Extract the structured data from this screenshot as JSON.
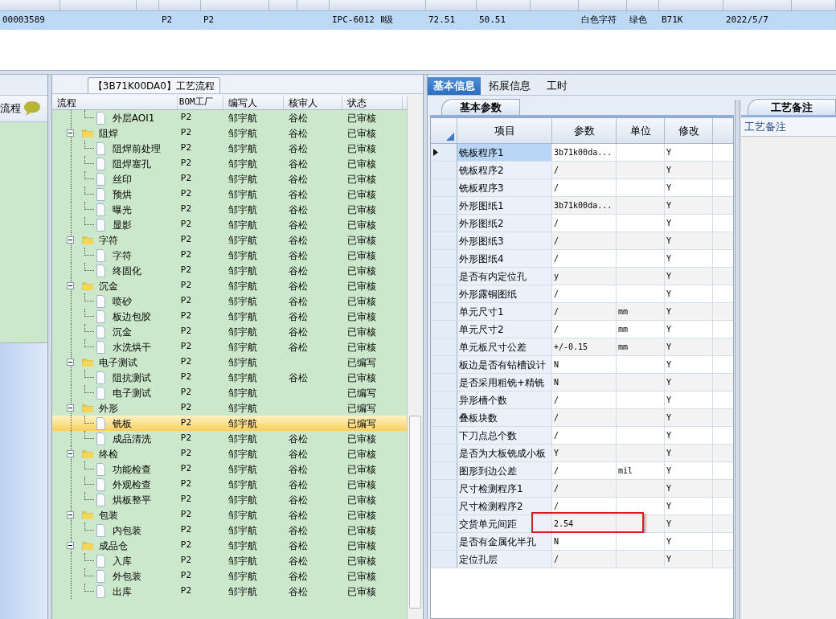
{
  "top_grid": {
    "row": {
      "selected": true,
      "cells": [
        "00003589",
        "",
        "",
        "P2",
        "P2",
        "",
        "",
        "IPC-6012 Ⅱ级",
        "72.51",
        "50.51",
        "",
        "白色字符",
        "绿色",
        "B71K",
        "2022/5/7",
        ""
      ]
    }
  },
  "left_panel": {
    "title": "流程"
  },
  "flow_panel": {
    "title": "【3B71K00DA0】工艺流程",
    "columns": [
      "流程",
      "BOM工厂",
      "编写人",
      "核审人",
      "状态"
    ],
    "nodes": [
      {
        "kind": "leaf",
        "label": "外层AOI1",
        "bom": "P2",
        "writer": "邹宇航",
        "reviewer": "谷松",
        "status": "已审核",
        "selected": false
      },
      {
        "kind": "group",
        "label": "阻焊",
        "expanded": true,
        "bom": "P2",
        "writer": "邹宇航",
        "reviewer": "谷松",
        "status": "已审核",
        "selected": false,
        "children": [
          {
            "kind": "leaf",
            "label": "阻焊前处理",
            "bom": "P2",
            "writer": "邹宇航",
            "reviewer": "谷松",
            "status": "已审核",
            "selected": false
          },
          {
            "kind": "leaf",
            "label": "阻焊塞孔",
            "bom": "P2",
            "writer": "邹宇航",
            "reviewer": "谷松",
            "status": "已审核",
            "selected": false
          },
          {
            "kind": "leaf",
            "label": "丝印",
            "bom": "P2",
            "writer": "邹宇航",
            "reviewer": "谷松",
            "status": "已审核",
            "selected": false
          },
          {
            "kind": "leaf",
            "label": "预烘",
            "bom": "P2",
            "writer": "邹宇航",
            "reviewer": "谷松",
            "status": "已审核",
            "selected": false
          },
          {
            "kind": "leaf",
            "label": "曝光",
            "bom": "P2",
            "writer": "邹宇航",
            "reviewer": "谷松",
            "status": "已审核",
            "selected": false
          },
          {
            "kind": "leaf",
            "label": "显影",
            "bom": "P2",
            "writer": "邹宇航",
            "reviewer": "谷松",
            "status": "已审核",
            "selected": false
          }
        ]
      },
      {
        "kind": "group",
        "label": "字符",
        "expanded": true,
        "bom": "P2",
        "writer": "邹宇航",
        "reviewer": "谷松",
        "status": "已审核",
        "selected": false,
        "children": [
          {
            "kind": "leaf",
            "label": "字符",
            "bom": "P2",
            "writer": "邹宇航",
            "reviewer": "谷松",
            "status": "已审核",
            "selected": false
          },
          {
            "kind": "leaf",
            "label": "终固化",
            "bom": "P2",
            "writer": "邹宇航",
            "reviewer": "谷松",
            "status": "已审核",
            "selected": false
          }
        ]
      },
      {
        "kind": "group",
        "label": "沉金",
        "expanded": true,
        "bom": "P2",
        "writer": "邹宇航",
        "reviewer": "谷松",
        "status": "已审核",
        "selected": false,
        "children": [
          {
            "kind": "leaf",
            "label": "喷砂",
            "bom": "P2",
            "writer": "邹宇航",
            "reviewer": "谷松",
            "status": "已审核",
            "selected": false
          },
          {
            "kind": "leaf",
            "label": "板边包胶",
            "bom": "P2",
            "writer": "邹宇航",
            "reviewer": "谷松",
            "status": "已审核",
            "selected": false
          },
          {
            "kind": "leaf",
            "label": "沉金",
            "bom": "P2",
            "writer": "邹宇航",
            "reviewer": "谷松",
            "status": "已审核",
            "selected": false
          },
          {
            "kind": "leaf",
            "label": "水洗烘干",
            "bom": "P2",
            "writer": "邹宇航",
            "reviewer": "谷松",
            "status": "已审核",
            "selected": false
          }
        ]
      },
      {
        "kind": "group",
        "label": "电子测试",
        "expanded": true,
        "bom": "P2",
        "writer": "邹宇航",
        "status": "已编写",
        "selected": false,
        "children": [
          {
            "kind": "leaf",
            "label": "阻抗测试",
            "bom": "P2",
            "writer": "邹宇航",
            "reviewer": "谷松",
            "status": "已审核",
            "selected": false
          },
          {
            "kind": "leaf",
            "label": "电子测试",
            "bom": "P2",
            "writer": "邹宇航",
            "status": "已编写",
            "selected": false
          }
        ]
      },
      {
        "kind": "group",
        "label": "外形",
        "expanded": true,
        "bom": "P2",
        "writer": "邹宇航",
        "status": "已编写",
        "selected": false,
        "children": [
          {
            "kind": "leaf",
            "label": "铣板",
            "bom": "P2",
            "writer": "邹宇航",
            "status": "已编写",
            "selected": true
          },
          {
            "kind": "leaf",
            "label": "成品清洗",
            "bom": "P2",
            "writer": "邹宇航",
            "reviewer": "谷松",
            "status": "已审核",
            "selected": false
          }
        ]
      },
      {
        "kind": "group",
        "label": "终检",
        "expanded": true,
        "bom": "P2",
        "writer": "邹宇航",
        "reviewer": "谷松",
        "status": "已审核",
        "selected": false,
        "children": [
          {
            "kind": "leaf",
            "label": "功能检查",
            "bom": "P2",
            "writer": "邹宇航",
            "reviewer": "谷松",
            "status": "已审核",
            "selected": false
          },
          {
            "kind": "leaf",
            "label": "外观检查",
            "bom": "P2",
            "writer": "邹宇航",
            "reviewer": "谷松",
            "status": "已审核",
            "selected": false
          },
          {
            "kind": "leaf",
            "label": "烘板整平",
            "bom": "P2",
            "writer": "邹宇航",
            "reviewer": "谷松",
            "status": "已审核",
            "selected": false
          }
        ]
      },
      {
        "kind": "group",
        "label": "包装",
        "expanded": true,
        "bom": "P2",
        "writer": "邹宇航",
        "reviewer": "谷松",
        "status": "已审核",
        "selected": false,
        "children": [
          {
            "kind": "leaf",
            "label": "内包装",
            "bom": "P2",
            "writer": "邹宇航",
            "reviewer": "谷松",
            "status": "已审核",
            "selected": false
          }
        ]
      },
      {
        "kind": "group",
        "label": "成品仓",
        "expanded": true,
        "bom": "P2",
        "writer": "邹宇航",
        "reviewer": "谷松",
        "status": "已审核",
        "selected": false,
        "children": [
          {
            "kind": "leaf",
            "label": "入库",
            "bom": "P2",
            "writer": "邹宇航",
            "reviewer": "谷松",
            "status": "已审核",
            "selected": false
          },
          {
            "kind": "leaf",
            "label": "外包装",
            "bom": "P2",
            "writer": "邹宇航",
            "reviewer": "谷松",
            "status": "已审核",
            "selected": false
          },
          {
            "kind": "leaf",
            "label": "出库",
            "bom": "P2",
            "writer": "邹宇航",
            "reviewer": "谷松",
            "status": "已审核",
            "selected": false
          }
        ]
      }
    ]
  },
  "tabs": [
    {
      "label": "基本信息",
      "selected": true
    },
    {
      "label": "拓展信息",
      "selected": false
    },
    {
      "label": "工时",
      "selected": false
    }
  ],
  "params_panel": {
    "tab": "基本参数",
    "columns": [
      "项目",
      "参数",
      "单位",
      "修改"
    ],
    "rows": [
      {
        "item": "铣板程序1",
        "param": "3b71k00da...",
        "modify": "Y",
        "selected": true,
        "highlighted": false
      },
      {
        "item": "铣板程序2",
        "param": "/",
        "modify": "Y",
        "selected": false,
        "highlighted": false
      },
      {
        "item": "铣板程序3",
        "param": "/",
        "modify": "Y",
        "selected": false,
        "highlighted": false
      },
      {
        "item": "外形图纸1",
        "param": "3b71k00da...",
        "modify": "Y",
        "selected": false,
        "highlighted": false
      },
      {
        "item": "外形图纸2",
        "param": "/",
        "modify": "Y",
        "selected": false,
        "highlighted": false
      },
      {
        "item": "外形图纸3",
        "param": "/",
        "modify": "Y",
        "selected": false,
        "highlighted": false
      },
      {
        "item": "外形图纸4",
        "param": "/",
        "modify": "Y",
        "selected": false,
        "highlighted": false
      },
      {
        "item": "是否有内定位孔",
        "param": "y",
        "modify": "Y",
        "selected": false,
        "highlighted": false
      },
      {
        "item": "外形露铜图纸",
        "param": "/",
        "modify": "Y",
        "selected": false,
        "highlighted": false
      },
      {
        "item": "单元尺寸1",
        "param": "/",
        "unit": "mm",
        "modify": "Y",
        "selected": false,
        "highlighted": false
      },
      {
        "item": "单元尺寸2",
        "param": "/",
        "unit": "mm",
        "modify": "Y",
        "selected": false,
        "highlighted": false
      },
      {
        "item": "单元板尺寸公差",
        "param": "+/-0.15",
        "unit": "mm",
        "modify": "Y",
        "selected": false,
        "highlighted": false
      },
      {
        "item": "板边是否有钻槽设计",
        "param": "N",
        "modify": "Y",
        "selected": false,
        "highlighted": false
      },
      {
        "item": "是否采用粗铣+精铣",
        "param": "N",
        "modify": "Y",
        "selected": false,
        "highlighted": false
      },
      {
        "item": "异形槽个数",
        "param": "/",
        "modify": "Y",
        "selected": false,
        "highlighted": false
      },
      {
        "item": "叠板块数",
        "param": "/",
        "modify": "Y",
        "selected": false,
        "highlighted": false
      },
      {
        "item": "下刀点总个数",
        "param": "/",
        "modify": "Y",
        "selected": false,
        "highlighted": false
      },
      {
        "item": "是否为大板铣成小板",
        "param": "Y",
        "modify": "Y",
        "selected": false,
        "highlighted": false
      },
      {
        "item": "图形到边公差",
        "param": "/",
        "unit": "mil",
        "modify": "Y",
        "selected": false,
        "highlighted": false
      },
      {
        "item": "尺寸检测程序1",
        "param": "/",
        "modify": "Y",
        "selected": false,
        "highlighted": false
      },
      {
        "item": "尺寸检测程序2",
        "param": "/",
        "modify": "Y",
        "selected": false,
        "highlighted": false
      },
      {
        "item": "交货单元间距",
        "param": "2.54",
        "modify": "Y",
        "selected": false,
        "highlighted": true
      },
      {
        "item": "是否有金属化半孔",
        "param": "N",
        "modify": "Y",
        "selected": false,
        "highlighted": false
      },
      {
        "item": "定位孔层",
        "param": "/",
        "modify": "Y",
        "selected": false,
        "highlighted": false
      }
    ]
  },
  "notes_panel": {
    "tab": "工艺备注",
    "label": "工艺备注"
  }
}
